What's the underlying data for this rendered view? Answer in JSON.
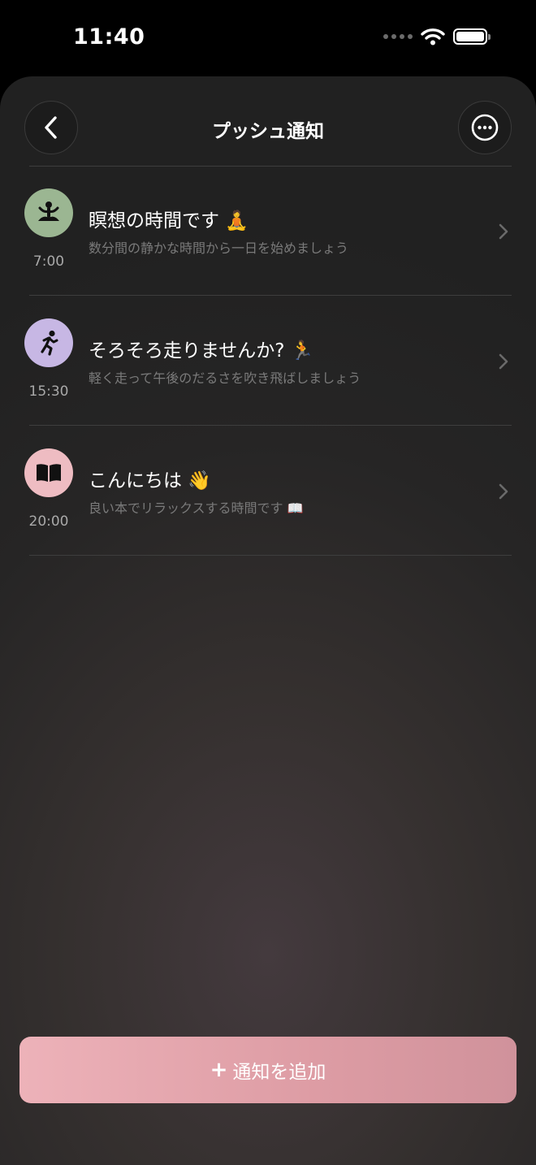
{
  "status_bar": {
    "time": "11:40"
  },
  "header": {
    "title": "プッシュ通知"
  },
  "notifications": [
    {
      "time": "7:00",
      "title": "瞑想の時間です 🧘",
      "subtitle": "数分間の静かな時間から一日を始めましょう",
      "icon": "meditation-icon",
      "icon_bg": "#9bb692"
    },
    {
      "time": "15:30",
      "title": "そろそろ走りませんか? 🏃",
      "subtitle": "軽く走って午後のだるさを吹き飛ばしましょう",
      "icon": "running-icon",
      "icon_bg": "#c7b7e4"
    },
    {
      "time": "20:00",
      "title": "こんにちは 👋",
      "subtitle": "良い本でリラックスする時間です 📖",
      "icon": "book-icon",
      "icon_bg": "#eebcc2"
    }
  ],
  "add_button": {
    "label": "通知を追加"
  },
  "colors": {
    "accent": "#e6a8b0",
    "background": "#222222"
  }
}
